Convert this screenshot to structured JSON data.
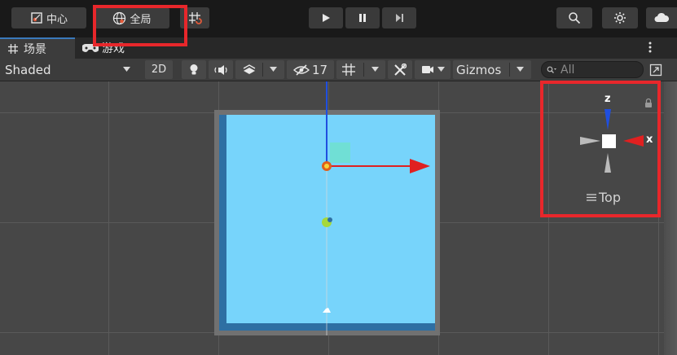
{
  "toolbar_top": {
    "pivot_label": "中心",
    "space_label": "全局",
    "play_icon": "play-icon",
    "pause_icon": "pause-icon",
    "step_icon": "step-icon",
    "search_icon": "search-icon",
    "settings_icon": "gear-icon",
    "cloud_icon": "cloud-icon"
  },
  "tabs": [
    {
      "label": "场景",
      "icon": "grid-icon"
    },
    {
      "label": "游戏",
      "icon": "gamepad-icon"
    }
  ],
  "scene_toolbar": {
    "shading_mode": "Shaded",
    "mode_2d": "2D",
    "hidden_count": "17",
    "gizmos_label": "Gizmos",
    "search_placeholder": "All"
  },
  "orientation_gizmo": {
    "axis_z": "z",
    "axis_x": "x",
    "view_label": "Top"
  },
  "colors": {
    "highlight": "#e8272b",
    "sprite_fill": "#77d4fb",
    "sprite_shadow": "#2e6fa3",
    "axis_x": "#e02020",
    "axis_z": "#1f4fe0"
  }
}
